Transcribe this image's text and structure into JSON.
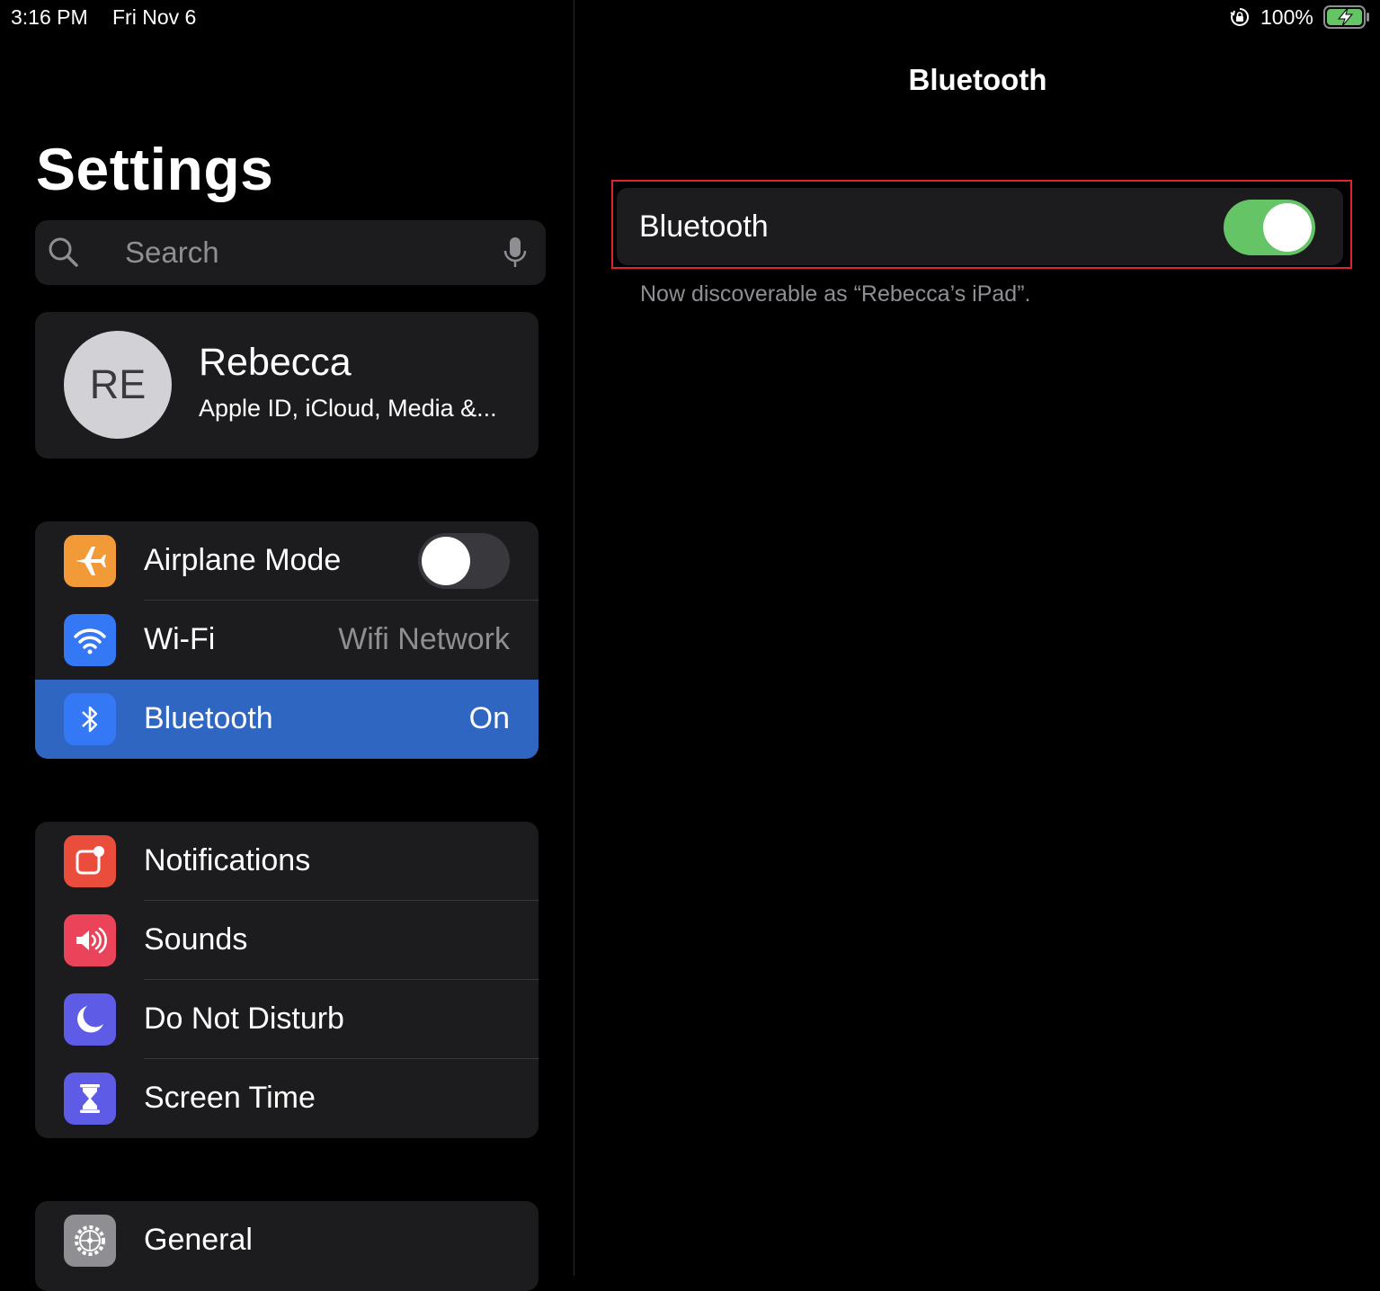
{
  "status_bar": {
    "time": "3:16 PM",
    "date": "Fri Nov 6",
    "battery": "100%"
  },
  "master": {
    "title": "Settings",
    "search": {
      "placeholder": "Search"
    },
    "profile": {
      "initials": "RE",
      "name": "Rebecca",
      "subtitle": "Apple ID, iCloud, Media &..."
    },
    "group1": [
      {
        "label": "Airplane Mode",
        "toggle": "off",
        "icon": "airplane-icon",
        "color": "#f19a37"
      },
      {
        "label": "Wi-Fi",
        "value": "Wifi Network",
        "icon": "wifi-icon",
        "color": "#3478f6"
      },
      {
        "label": "Bluetooth",
        "value": "On",
        "icon": "bluetooth-icon",
        "color": "#3478f6",
        "selected": true
      }
    ],
    "group2": [
      {
        "label": "Notifications",
        "icon": "notifications-icon",
        "color": "#eb4d3d"
      },
      {
        "label": "Sounds",
        "icon": "sounds-icon",
        "color": "#eb445a"
      },
      {
        "label": "Do Not Disturb",
        "icon": "moon-icon",
        "color": "#5e5ce6"
      },
      {
        "label": "Screen Time",
        "icon": "hourglass-icon",
        "color": "#5e5ce6"
      }
    ],
    "group3": [
      {
        "label": "General",
        "icon": "gear-icon",
        "color": "#8e8e93"
      }
    ]
  },
  "detail": {
    "title": "Bluetooth",
    "toggle_label": "Bluetooth",
    "toggle_state": "on",
    "footer": "Now discoverable as “Rebecca’s iPad”."
  }
}
